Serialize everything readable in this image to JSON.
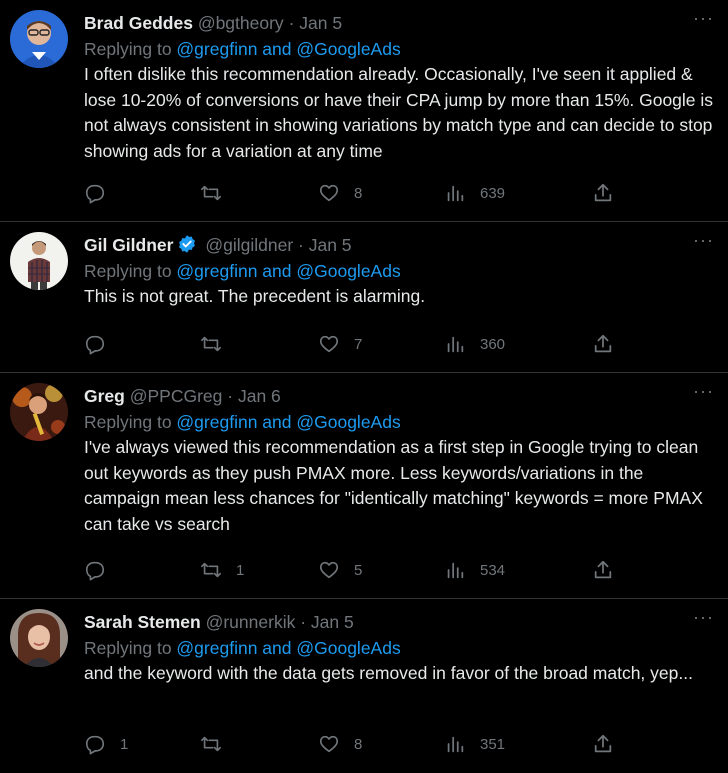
{
  "tweets": [
    {
      "name": "Brad Geddes",
      "handle": "@bgtheory",
      "dot": "·",
      "date": "Jan 5",
      "verified": false,
      "replying_prefix": "Replying to ",
      "replying_to": "@gregfinn and @GoogleAds",
      "text": "I often dislike this recommendation already. Occasionally, I've seen it applied & lose 10-20% of conversions or have their CPA jump by more than 15%. Google is not always consistent in showing variations by match type and can decide to stop showing ads for a variation at any time",
      "replies": "",
      "retweets": "",
      "likes": "8",
      "views": "639",
      "more": "···"
    },
    {
      "name": "Gil Gildner",
      "handle": "@gilgildner",
      "dot": "·",
      "date": "Jan 5",
      "verified": true,
      "replying_prefix": "Replying to ",
      "replying_to": "@gregfinn and @GoogleAds",
      "text": "This is not great. The precedent is alarming.",
      "replies": "",
      "retweets": "",
      "likes": "7",
      "views": "360",
      "more": "···"
    },
    {
      "name": "Greg",
      "handle": "@PPCGreg",
      "dot": "·",
      "date": "Jan 6",
      "verified": false,
      "replying_prefix": "Replying to ",
      "replying_to": "@gregfinn and @GoogleAds",
      "text": "I've always viewed this recommendation as a first step in Google trying to clean out keywords as they push PMAX more. Less keywords/variations in the campaign mean less chances for \"identically matching\" keywords = more PMAX can take vs search",
      "replies": "",
      "retweets": "1",
      "likes": "5",
      "views": "534",
      "more": "···"
    },
    {
      "name": "Sarah Stemen",
      "handle": "@runnerkik",
      "dot": "·",
      "date": "Jan 5",
      "verified": false,
      "replying_prefix": "Replying to ",
      "replying_to": "@gregfinn and @GoogleAds",
      "text": "and the keyword with the data gets removed in favor of the broad match, yep...",
      "replies": "1",
      "retweets": "",
      "likes": "8",
      "views": "351",
      "more": "···"
    }
  ],
  "colors": {
    "background": "#000000",
    "text": "#e7e9ea",
    "muted": "#71767b",
    "link": "#1d9bf0",
    "divider": "#2f3336"
  }
}
